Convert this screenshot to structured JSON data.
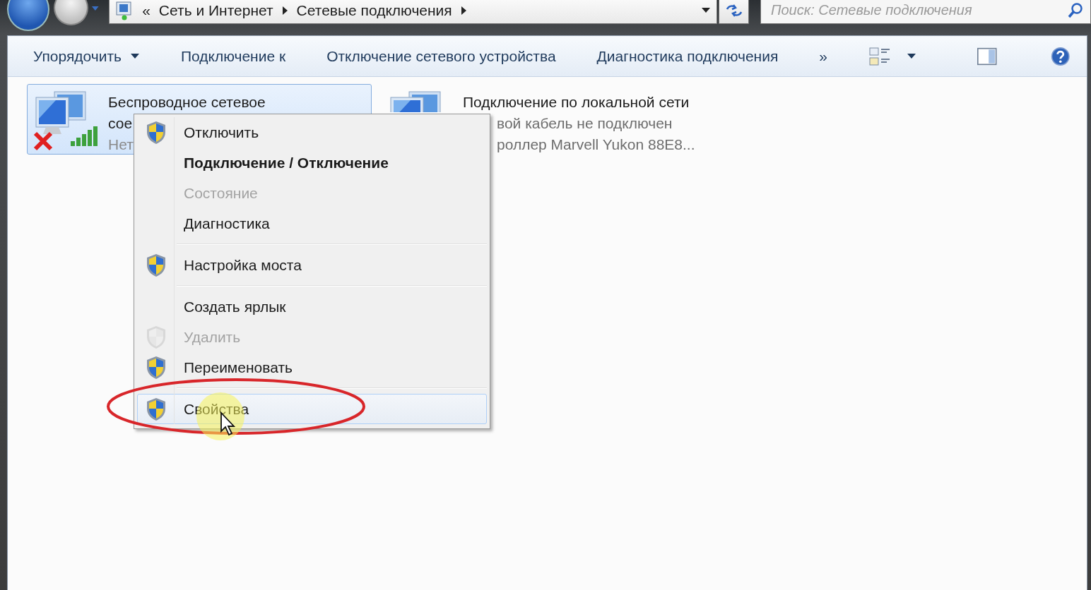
{
  "address_bar": {
    "overflow": "«",
    "crumbs": [
      "Сеть и Интернет",
      "Сетевые подключения"
    ]
  },
  "search": {
    "placeholder": "Поиск: Сетевые подключения"
  },
  "toolbar": {
    "commands": [
      {
        "label": "Упорядочить",
        "dropdown": true
      },
      {
        "label": "Подключение к",
        "dropdown": false
      },
      {
        "label": "Отключение сетевого устройства",
        "dropdown": false
      },
      {
        "label": "Диагностика подключения",
        "dropdown": false
      }
    ],
    "more": "»"
  },
  "connections": [
    {
      "kind": "wireless",
      "selected": true,
      "disconnected": true,
      "lines": [
        "Беспроводное сетевое",
        "сое",
        "Нет"
      ]
    },
    {
      "kind": "wired",
      "selected": false,
      "lines": [
        "Подключение по локальной сети",
        "вой кабель не подключен",
        "роллер Marvell Yukon 88E8..."
      ]
    }
  ],
  "context_menu": {
    "groups": [
      [
        {
          "label": "Отключить",
          "shield": true,
          "disabled": false,
          "default": false,
          "selected": false
        },
        {
          "label": "Подключение / Отключение",
          "shield": false,
          "disabled": false,
          "default": true,
          "selected": false
        },
        {
          "label": "Состояние",
          "shield": false,
          "disabled": true,
          "default": false,
          "selected": false
        },
        {
          "label": "Диагностика",
          "shield": false,
          "disabled": false,
          "default": false,
          "selected": false
        }
      ],
      [
        {
          "label": "Настройка моста",
          "shield": true,
          "disabled": false,
          "default": false,
          "selected": false
        }
      ],
      [
        {
          "label": "Создать ярлык",
          "shield": false,
          "disabled": false,
          "default": false,
          "selected": false
        },
        {
          "label": "Удалить",
          "shield": true,
          "disabled": true,
          "default": false,
          "selected": false
        },
        {
          "label": "Переименовать",
          "shield": true,
          "disabled": false,
          "default": false,
          "selected": false
        }
      ],
      [
        {
          "label": "Свойства",
          "shield": true,
          "disabled": false,
          "default": false,
          "selected": true
        }
      ]
    ]
  }
}
